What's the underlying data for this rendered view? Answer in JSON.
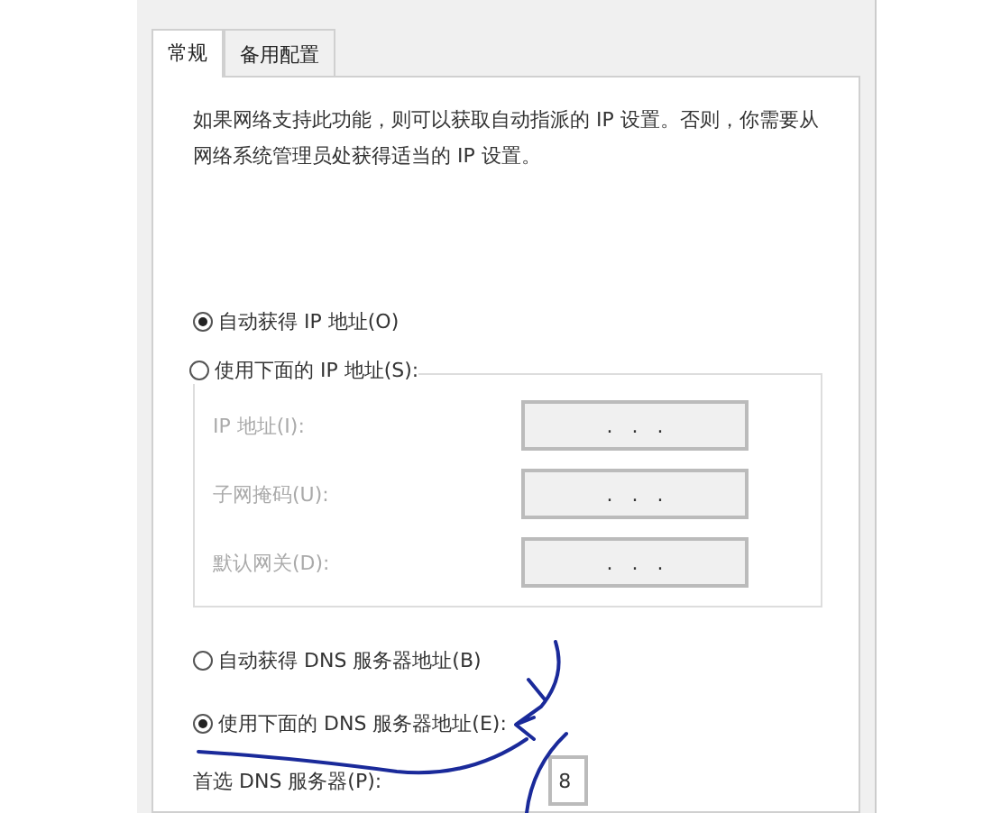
{
  "tabs": [
    {
      "label": "常规",
      "selected": true
    },
    {
      "label": "备用配置",
      "selected": false
    }
  ],
  "description": "如果网络支持此功能，则可以获取自动指派的 IP 设置。否则，你需要从网络系统管理员处获得适当的 IP 设置。",
  "ip_mode": [
    {
      "label": "自动获得 IP 地址(O)",
      "selected": true
    },
    {
      "label": "使用下面的 IP 地址(S):",
      "selected": false
    }
  ],
  "ip_fields": [
    {
      "label": "IP 地址(I):",
      "value": ".   .   .",
      "disabled": true
    },
    {
      "label": "子网掩码(U):",
      "value": ".   .   .",
      "disabled": true
    },
    {
      "label": "默认网关(D):",
      "value": ".   .   .",
      "disabled": true
    }
  ],
  "dns_mode": [
    {
      "label": "自动获得 DNS 服务器地址(B)",
      "selected": false
    },
    {
      "label": "使用下面的 DNS 服务器地址(E):",
      "selected": true
    }
  ],
  "dns_fields": [
    {
      "label": "首选 DNS 服务器(P):",
      "value": "8",
      "disabled": false
    }
  ]
}
